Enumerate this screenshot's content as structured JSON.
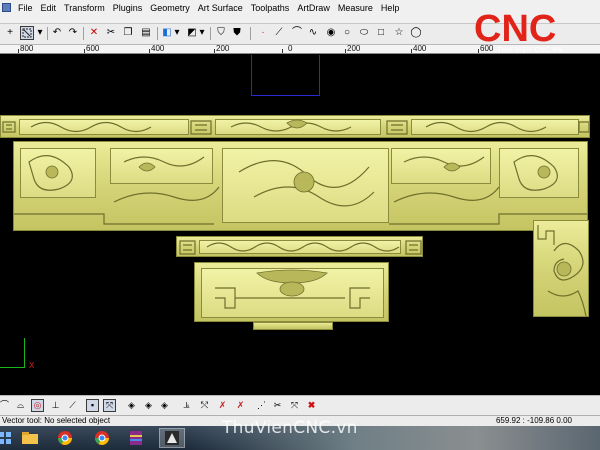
{
  "menu": {
    "items": [
      "File",
      "Edit",
      "Transform",
      "Plugins",
      "Geometry",
      "Art Surface",
      "Toolpaths",
      "ArtDraw",
      "Measure",
      "Help"
    ]
  },
  "ruler": {
    "labels": [
      "800",
      "600",
      "400",
      "200",
      "0",
      "200",
      "400",
      "600"
    ]
  },
  "viewport": {
    "axis_label": "X"
  },
  "logo": {
    "brand": "CNC",
    "tagline": "THƯ VIỆN CNC.VN",
    "brand_color": "#e2231a"
  },
  "status": {
    "text": "Vector tool: No selected object",
    "coords": "659.92 : -109.86  0.00"
  },
  "watermark": "ThuVienCNC.vn",
  "icons": {
    "toolbar": [
      "plus-icon",
      "select-box-icon",
      "undo-icon",
      "redo-icon",
      "delete-icon",
      "cut-icon",
      "copy-icon",
      "paste-icon",
      "layer-icon",
      "color-icon",
      "eye-icon",
      "shield-icon",
      "shield-filled-icon",
      "node-icon",
      "line-icon",
      "arc-icon",
      "curve-icon",
      "circle-tool-icon",
      "circle-icon",
      "ellipse-icon",
      "rectangle-icon",
      "star-icon",
      "polygon-icon"
    ],
    "bottom_toolbar": [
      "arc-tool-icon",
      "fillet-icon",
      "circle-target-icon",
      "perpendicular-icon",
      "tangent-icon",
      "snap-node-icon",
      "snap-active-icon",
      "diamond-icon",
      "diamond-cross-icon",
      "diamond-dot-icon",
      "align-icon",
      "merge-icon",
      "split-icon",
      "join-icon",
      "vertex-icon",
      "scissor-icon",
      "close-red-icon"
    ],
    "taskbar": [
      "windows-start-icon",
      "file-explorer-icon",
      "chrome-icon",
      "chrome-alt-icon",
      "winrar-icon",
      "artcam-icon"
    ]
  }
}
